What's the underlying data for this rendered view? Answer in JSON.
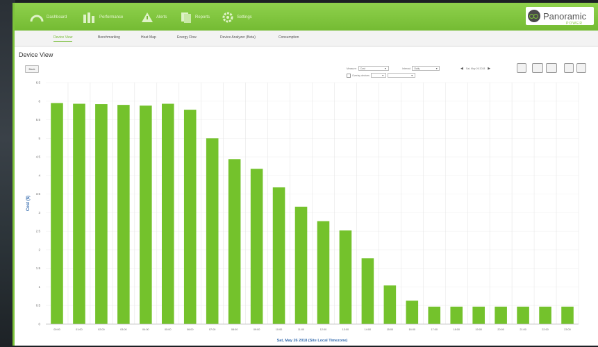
{
  "nav": {
    "items": [
      {
        "label": "Dashboard",
        "icon": "gauge-icon"
      },
      {
        "label": "Performance",
        "icon": "bar-chart-icon"
      },
      {
        "label": "Alerts",
        "icon": "warning-icon"
      },
      {
        "label": "Reports",
        "icon": "reports-icon"
      },
      {
        "label": "Settings",
        "icon": "gear-icon"
      }
    ],
    "logo_text": "Panoramic",
    "logo_sub": "POWER"
  },
  "subtabs": [
    {
      "label": "Device View",
      "active": true
    },
    {
      "label": "Benchmarking",
      "active": false
    },
    {
      "label": "Heat Map",
      "active": false
    },
    {
      "label": "Energy Flow",
      "active": false
    },
    {
      "label": "Device Analyzer (Beta)",
      "active": false
    },
    {
      "label": "Consumption",
      "active": false
    }
  ],
  "page_title": "Device View",
  "back_label": "Back",
  "controls": {
    "measure_label": "Measure:",
    "measure_value": "Cost",
    "interval_label": "Interval:",
    "interval_value": "Daily",
    "date_text": "Sat, May 26 2018",
    "overlay_label": "Overlay devices"
  },
  "colors": {
    "accent": "#74bb33",
    "bar": "#74c22c"
  },
  "chart_data": {
    "type": "bar",
    "categories": [
      "00:00",
      "01:00",
      "02:00",
      "03:00",
      "04:00",
      "05:00",
      "06:00",
      "07:00",
      "08:00",
      "09:00",
      "10:00",
      "11:00",
      "12:00",
      "13:00",
      "14:00",
      "15:00",
      "16:00",
      "17:00",
      "18:00",
      "19:00",
      "20:00",
      "21:00",
      "22:00",
      "23:00"
    ],
    "values": [
      5.95,
      5.93,
      5.92,
      5.9,
      5.88,
      5.93,
      5.77,
      5.0,
      4.44,
      4.18,
      3.68,
      3.16,
      2.77,
      2.52,
      1.77,
      1.04,
      0.63,
      0.47,
      0.47,
      0.47,
      0.47,
      0.47,
      0.47,
      0.47
    ],
    "yticks": [
      "0",
      "0.5",
      "1",
      "1.5",
      "2",
      "2.5",
      "3",
      "3.5",
      "4",
      "4.5",
      "5",
      "5.5",
      "6",
      "6.5"
    ],
    "ylim": [
      0,
      6.5
    ],
    "ylabel": "Cost ($)",
    "xlabel": "Sat, May 26 2018 (Site Local Timezone)"
  }
}
